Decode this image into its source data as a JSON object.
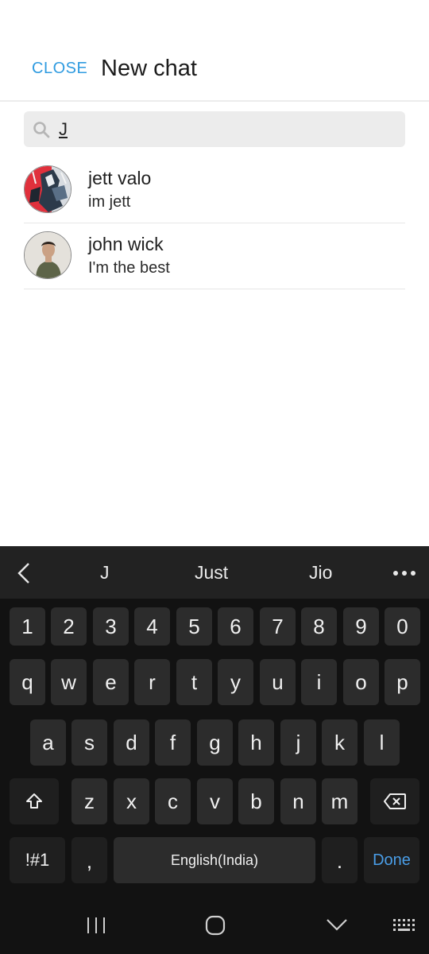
{
  "header": {
    "close_label": "CLOSE",
    "title": "New chat"
  },
  "search": {
    "value": "J",
    "icon": "search-icon"
  },
  "contacts": [
    {
      "name": "jett valo",
      "status": "im jett"
    },
    {
      "name": "john wick",
      "status": "I'm the best"
    }
  ],
  "keyboard": {
    "suggestions": [
      "J",
      "Just",
      "Jio"
    ],
    "numbers": [
      "1",
      "2",
      "3",
      "4",
      "5",
      "6",
      "7",
      "8",
      "9",
      "0"
    ],
    "row1": [
      "q",
      "w",
      "e",
      "r",
      "t",
      "y",
      "u",
      "i",
      "o",
      "p"
    ],
    "row2": [
      "a",
      "s",
      "d",
      "f",
      "g",
      "h",
      "j",
      "k",
      "l"
    ],
    "row3": [
      "z",
      "x",
      "c",
      "v",
      "b",
      "n",
      "m"
    ],
    "symbols_label": "!#1",
    "comma": ",",
    "space_label": "English(India)",
    "period": ".",
    "done_label": "Done"
  },
  "colors": {
    "accent": "#2f9be0",
    "keyboard_bg": "#121212",
    "key_bg": "#2c2c2c",
    "done": "#4a9ee8"
  }
}
